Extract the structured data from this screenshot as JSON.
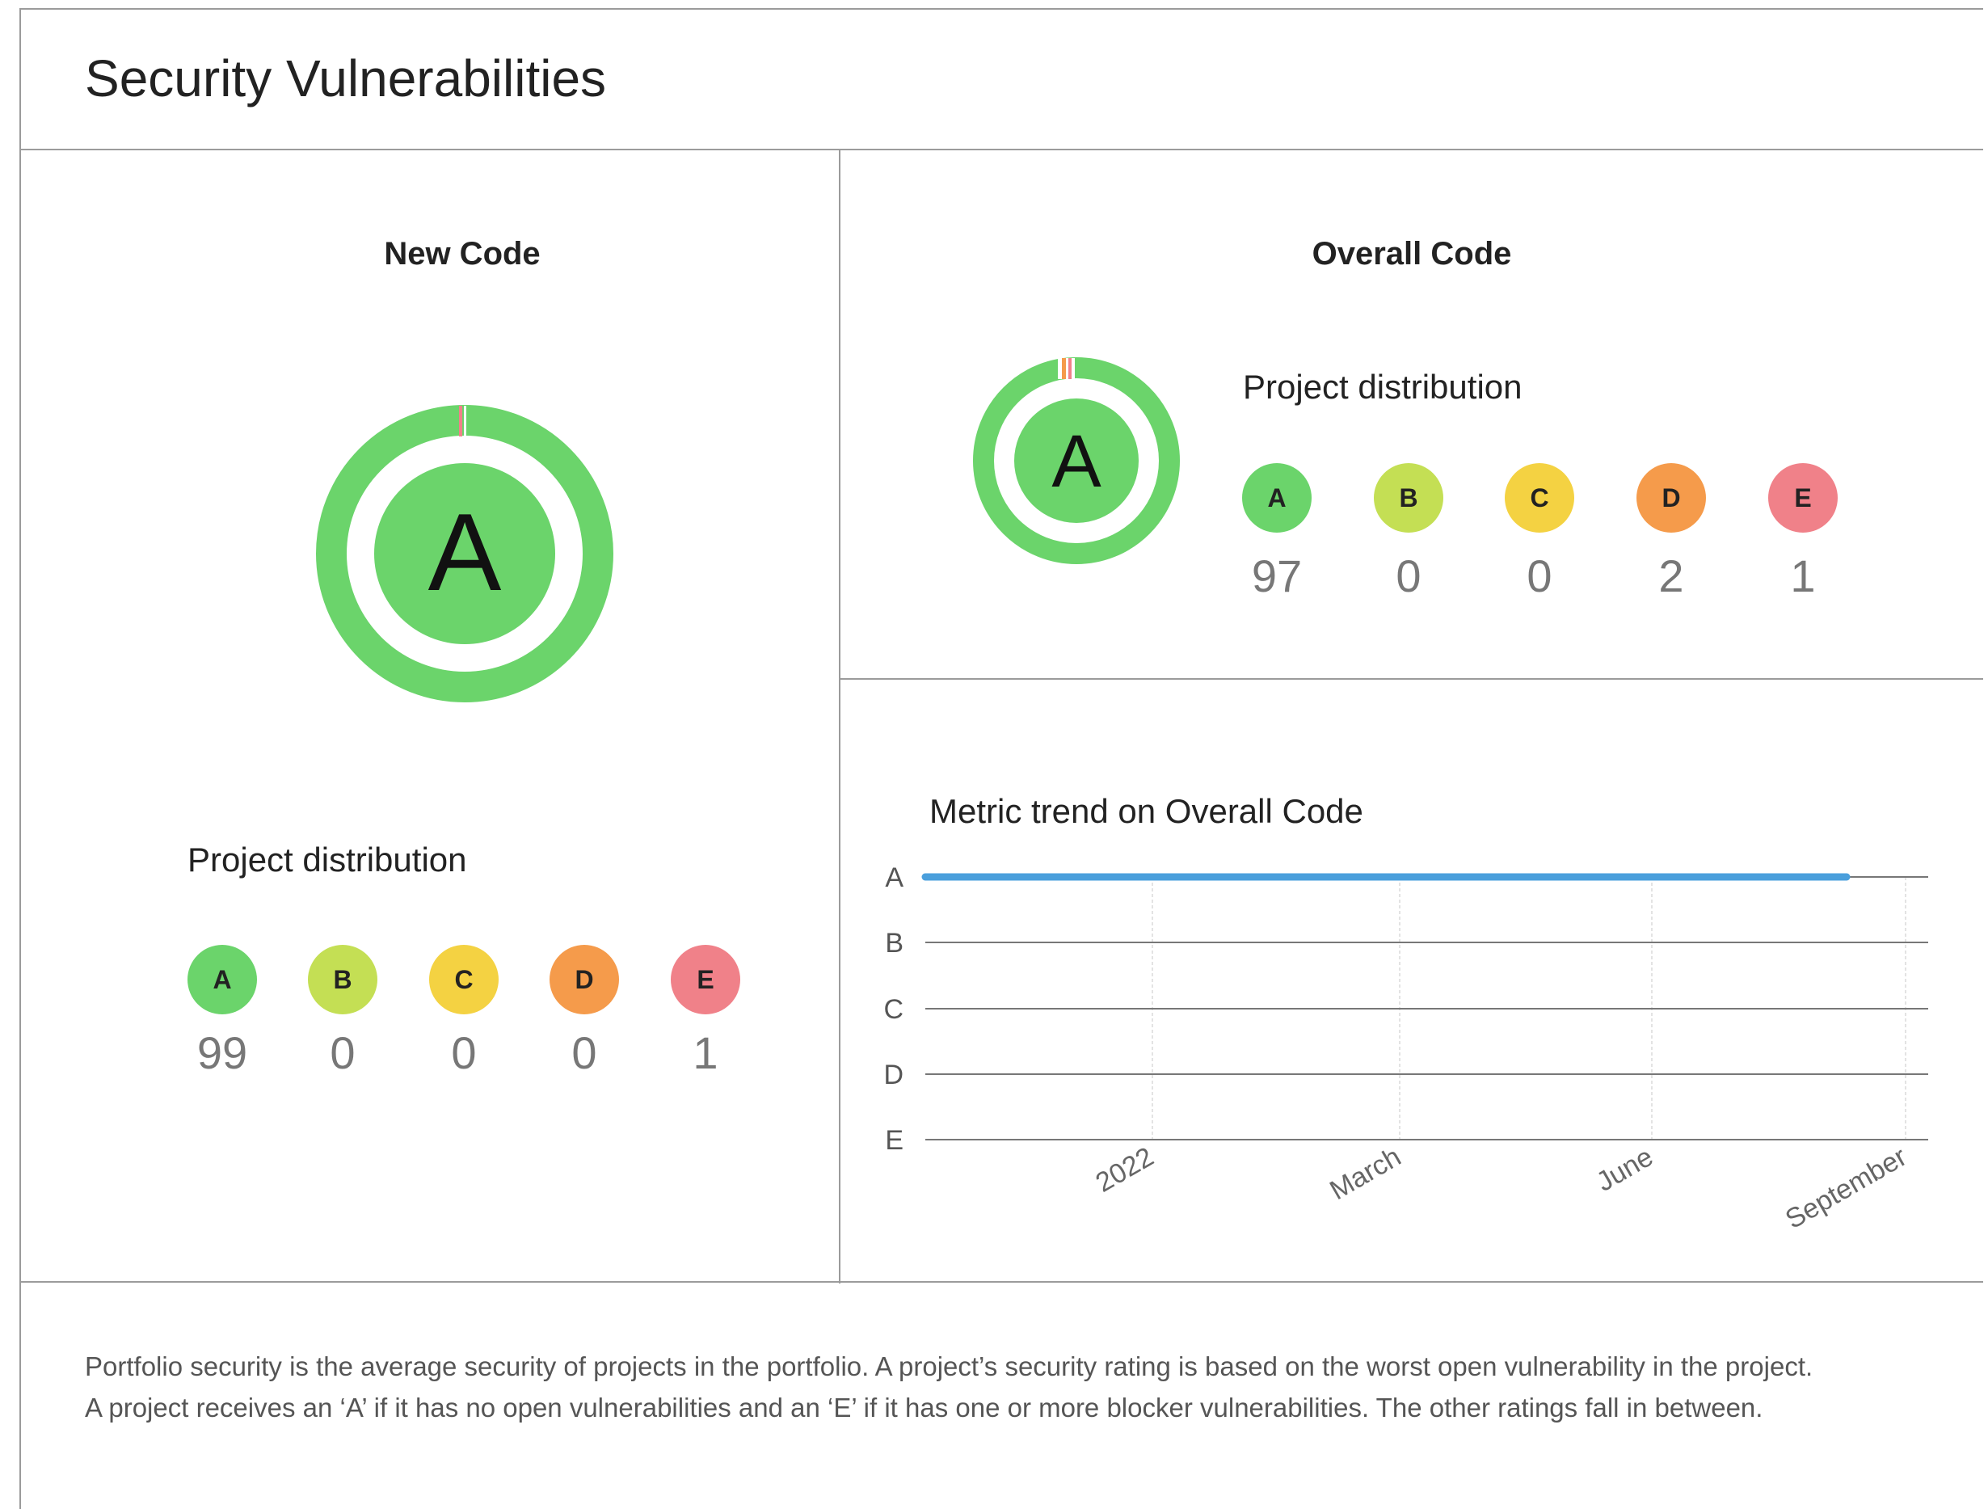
{
  "title": "Security Vulnerabilities",
  "new_code": {
    "heading": "New Code",
    "rating": "A",
    "distribution_title": "Project distribution",
    "distribution": [
      {
        "label": "A",
        "count": "99",
        "color": "#6bd46b"
      },
      {
        "label": "B",
        "count": "0",
        "color": "#c4df54"
      },
      {
        "label": "C",
        "count": "0",
        "color": "#f4d242"
      },
      {
        "label": "D",
        "count": "0",
        "color": "#f59b4b"
      },
      {
        "label": "E",
        "count": "1",
        "color": "#f08189"
      }
    ]
  },
  "overall_code": {
    "heading": "Overall Code",
    "rating": "A",
    "distribution_title": "Project distribution",
    "distribution": [
      {
        "label": "A",
        "count": "97",
        "color": "#6bd46b"
      },
      {
        "label": "B",
        "count": "0",
        "color": "#c4df54"
      },
      {
        "label": "C",
        "count": "0",
        "color": "#f4d242"
      },
      {
        "label": "D",
        "count": "2",
        "color": "#f59b4b"
      },
      {
        "label": "E",
        "count": "1",
        "color": "#f08189"
      }
    ]
  },
  "trend": {
    "title": "Metric trend on Overall Code"
  },
  "chart_data": {
    "type": "line",
    "title": "Metric trend on Overall Code",
    "y_categories": [
      "A",
      "B",
      "C",
      "D",
      "E"
    ],
    "x_ticks": [
      "2022",
      "March",
      "June",
      "September"
    ],
    "series": [
      {
        "values": [
          {
            "x": "start",
            "y": "A"
          },
          {
            "x": "end",
            "y": "A"
          }
        ],
        "color": "#4a9fdc"
      }
    ],
    "grid": true
  },
  "footer": {
    "line1": "Portfolio security is the average security of projects in the portfolio. A project’s security rating is based on the worst open vulnerability in the project.",
    "line2": "A project receives an ‘A’ if it has no open vulnerabilities and an ‘E’ if it has one or more blocker vulnerabilities. The other ratings fall in between."
  },
  "colors": {
    "rating_green": "#6bd46b",
    "trend_blue": "#4a9fdc",
    "border": "#9b9b9b"
  }
}
